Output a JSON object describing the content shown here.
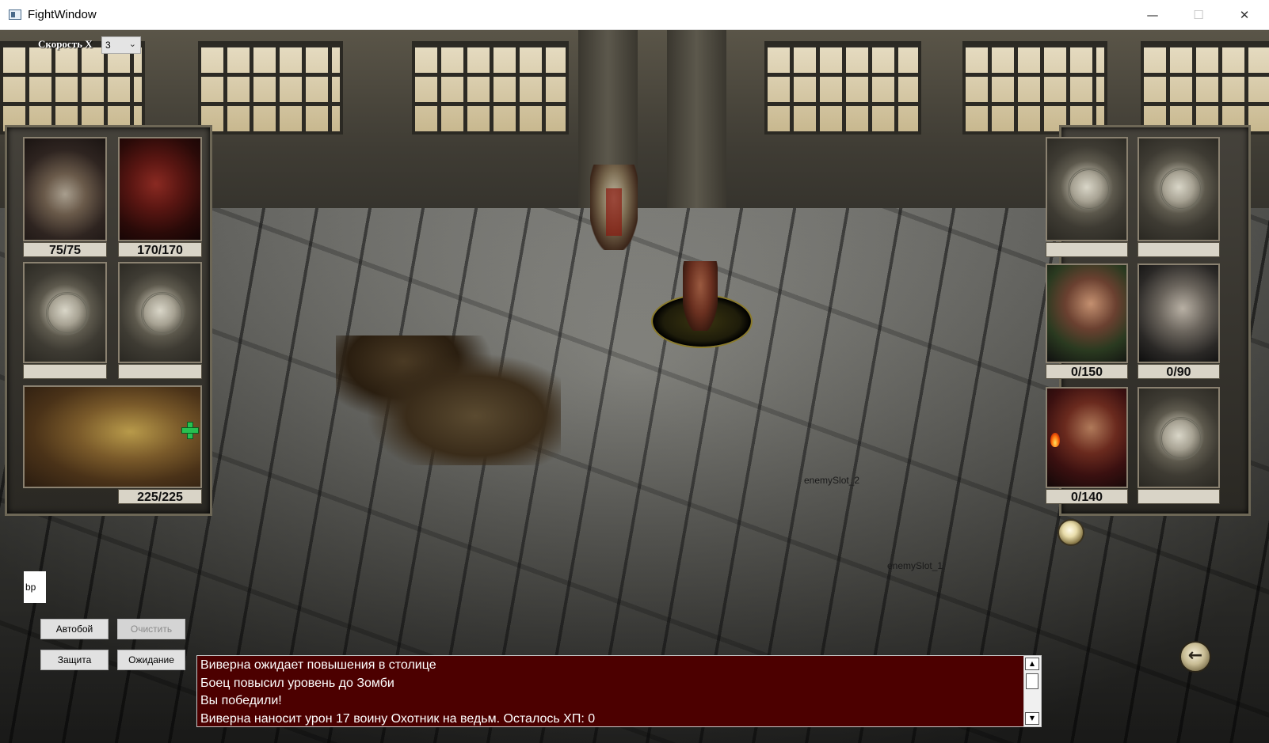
{
  "window": {
    "title": "FightWindow",
    "minimize": "—",
    "maximize": "☐",
    "close": "✕"
  },
  "speed": {
    "label": "Скорость X",
    "value": "3"
  },
  "player_units": [
    {
      "name": "lich",
      "hp": "75/75"
    },
    {
      "name": "ghoul",
      "hp": "170/170"
    },
    {
      "name": "empty",
      "hp": ""
    },
    {
      "name": "empty",
      "hp": ""
    },
    {
      "name": "wyvern",
      "hp": "225/225"
    }
  ],
  "enemy_units": [
    {
      "name": "empty",
      "hp": ""
    },
    {
      "name": "empty",
      "hp": ""
    },
    {
      "name": "hunter",
      "hp": "0/150"
    },
    {
      "name": "hunter",
      "hp": "0/90"
    },
    {
      "name": "hunter",
      "hp": "0/140"
    },
    {
      "name": "empty",
      "hp": ""
    }
  ],
  "field_labels": {
    "enemy_slot_2": "enemySlot_2",
    "enemy_slot_1": "enemySlot_1"
  },
  "controls": {
    "bp_text": "bp",
    "auto_label": "Автобой",
    "clear_label": "Очистить",
    "defend_label": "Защита",
    "wait_label": "Ожидание",
    "back_icon": "arrow-left-icon"
  },
  "log": {
    "lines": [
      "Виверна ожидает повышения в столице",
      "Боец повысил уровень до Зомби",
      "Вы победили!",
      "Виверна наносит урон 17 воину Охотник на ведьм. Осталось ХП: 0"
    ]
  },
  "colors": {
    "log_background": "#4c0000",
    "hp_bar": "#d9d4c7"
  }
}
